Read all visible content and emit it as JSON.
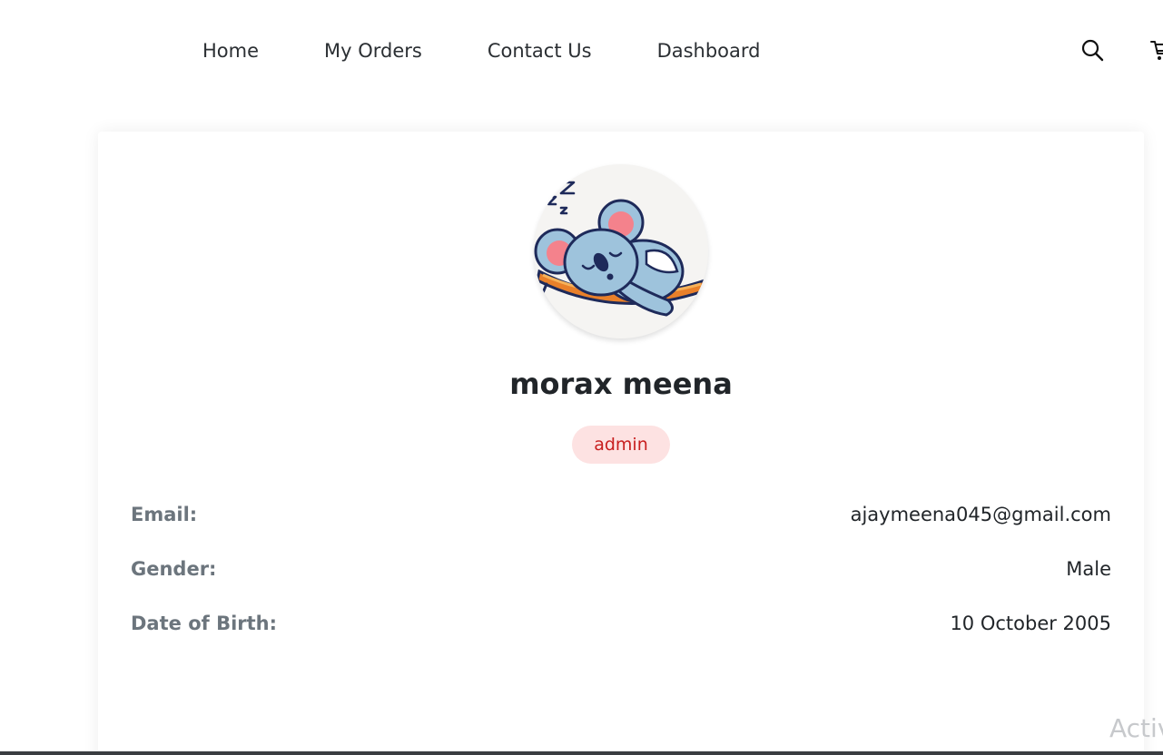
{
  "nav": {
    "links": [
      {
        "label": "Home"
      },
      {
        "label": "My Orders"
      },
      {
        "label": "Contact Us"
      },
      {
        "label": "Dashboard"
      }
    ],
    "search_icon": "search-icon",
    "cart_icon": "cart-icon"
  },
  "profile": {
    "avatar_icon": "koala-avatar",
    "name": "morax meena",
    "role": "admin",
    "fields": [
      {
        "label": "Email:",
        "value": "ajaymeena045@gmail.com"
      },
      {
        "label": "Gender:",
        "value": "Male"
      },
      {
        "label": "Date of Birth:",
        "value": "10 October 2005"
      }
    ]
  },
  "watermark": "Activ",
  "colors": {
    "badge_bg": "#fde2e2",
    "badge_text": "#c81e1e",
    "label_gray": "#6c757d",
    "text_dark": "#212529"
  }
}
